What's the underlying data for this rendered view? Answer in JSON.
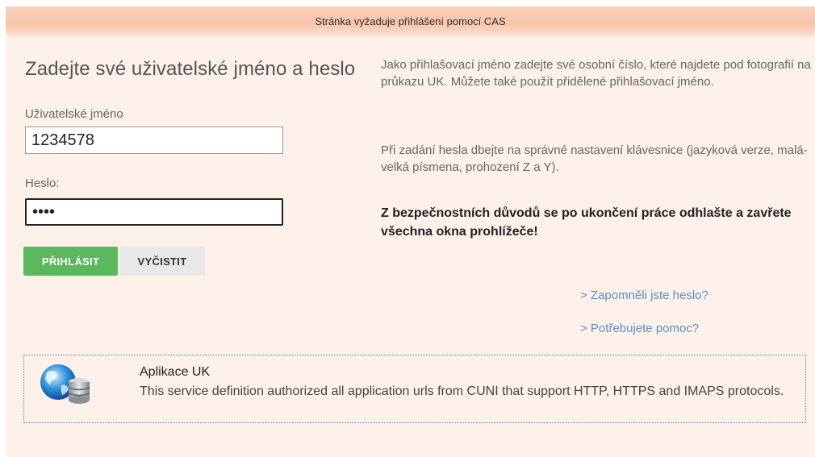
{
  "banner": {
    "title": "Stránka vyžaduje přihlášení pomocí CAS"
  },
  "login": {
    "heading": "Zadejte své uživatelské jméno a heslo",
    "username_label": "Uživatelské jméno",
    "username_value": "1234578",
    "password_label": "Heslo:",
    "password_value": "1234",
    "login_button": "PŘIHLÁSIT",
    "clear_button": "VYČISTIT"
  },
  "help": {
    "paragraph1": "Jako přihlašovací jméno zadejte své osobní číslo, které najdete pod fotografií na průkazu UK. Můžete také použít přidělené přihlašovací jméno.",
    "paragraph2": "Při zadání hesla dbejte na správné nastavení klávesnice (jazyková verze, malá-velká písmena, prohození Z a Y).",
    "warning": "Z bezpečnostních důvodů se po ukončení práce odhlašte a zavřete všechna okna prohlížeče!",
    "forgot_link": "> Zapomněli jste heslo?",
    "help_link": "> Potřebujete pomoc?"
  },
  "service": {
    "icon": "globe-database-icon",
    "title": "Aplikace UK",
    "description": "This service definition authorized all application urls from CUNI that support HTTP, HTTPS and IMAPS protocols."
  },
  "colors": {
    "panel_bg": "#fdf1ea",
    "banner_bg": "#f7c3a9",
    "login_button": "#5cb85c",
    "link": "#5b8fc7"
  }
}
